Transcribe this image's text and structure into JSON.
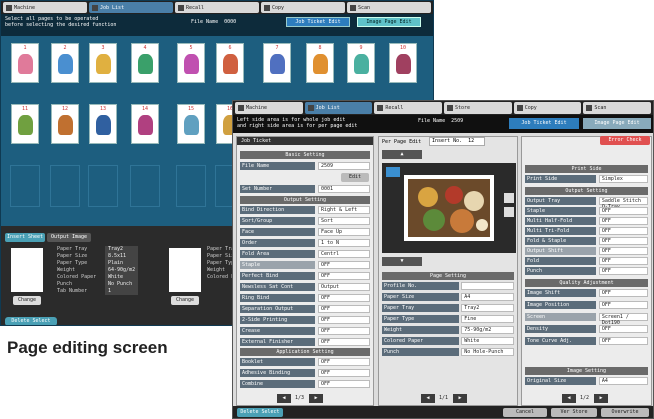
{
  "back_screen": {
    "tabs": [
      "Machine",
      "Job List",
      "Recall",
      "Copy",
      "Scan"
    ],
    "info_line1": "Select all pages to be operated",
    "info_line2": "before selecting the desired function",
    "file_name_label": "File Name",
    "file_name_value": "0000",
    "job_ticket_edit": "Job Ticket Edit",
    "image_page_edit": "Image Page Edit",
    "page_numbers": [
      "1",
      "2",
      "3",
      "4",
      "5",
      "6",
      "7",
      "8",
      "9",
      "10",
      "11",
      "12",
      "13",
      "14",
      "15",
      "16"
    ],
    "bottom_tabs": [
      "Insert Sheet",
      "Output Image"
    ],
    "sheet_labels": [
      "Paper Tray",
      "Paper Size",
      "Paper Type",
      "Weight",
      "Colored Paper",
      "Punch",
      "Tab Number"
    ],
    "sheet_values": [
      "Tray2",
      "8.5x11",
      "Plain",
      "64-90g/m2",
      "White",
      "No Punch",
      "1"
    ],
    "change_label": "Change",
    "delete_select": "Delete Select",
    "colors": {
      "accent": "#1d5e7f",
      "highlight": "#5fc2c9"
    }
  },
  "front_screen": {
    "tabs": [
      "Machine",
      "Job List",
      "Recall",
      "Store",
      "Copy",
      "Scan"
    ],
    "info_line1": "Left side area is for whole job edit",
    "info_line2": "and right side area is for per page edit",
    "file_name_label": "File Name",
    "file_name_value": "2509",
    "job_ticket_edit": "Job Ticket Edit",
    "image_page_edit": "Image Page Edit",
    "left_title": "Job Ticket",
    "basic_setting_header": "Basic Setting",
    "file_name_row": {
      "label": "File Name",
      "value": "2509"
    },
    "edit_btn": "Edit",
    "set_number_row": {
      "label": "Set Number",
      "value": "0001"
    },
    "output_setting_header": "Output Setting",
    "output_rows": [
      {
        "label": "Bind Direction",
        "value": "Right & Left"
      },
      {
        "label": "Sort/Group",
        "value": "Sort"
      },
      {
        "label": "Face",
        "value": "Face Up"
      },
      {
        "label": "Order",
        "value": "1 to N"
      },
      {
        "label": "Fold Area",
        "value": "Centrl"
      },
      {
        "label": "Staple",
        "value": "OFF"
      },
      {
        "label": "Perfect Bind",
        "value": "OFF"
      },
      {
        "label": "Newsless Sat Cont",
        "value": "Output"
      },
      {
        "label": "Ring Bind",
        "value": "OFF"
      },
      {
        "label": "Separation Output",
        "value": "OFF"
      },
      {
        "label": "2-Side Printing",
        "value": "OFF"
      },
      {
        "label": "Crease",
        "value": "OFF"
      },
      {
        "label": "External Finisher",
        "value": "OFF"
      }
    ],
    "application_header": "Application Setting",
    "application_rows": [
      {
        "label": "Booklet",
        "value": "OFF"
      },
      {
        "label": "Adhesive Binding",
        "value": "OFF"
      },
      {
        "label": "Combine",
        "value": "OFF"
      }
    ],
    "page_counter_left": "1/3",
    "per_page_edit": "Per Page Edit",
    "insert_no_label": "Insert No.",
    "insert_no_value": "12",
    "error_check": "Error Check",
    "page_setting_header": "Page Setting",
    "page_rows": [
      {
        "label": "Profile No.",
        "value": ""
      },
      {
        "label": "Paper Size",
        "value": "A4"
      },
      {
        "label": "Paper Tray",
        "value": "Tray2"
      },
      {
        "label": "Paper Type",
        "value": "Fine"
      },
      {
        "label": "Weight",
        "value": "75-90g/m2"
      },
      {
        "label": "Colored Paper",
        "value": "White"
      },
      {
        "label": "Punch",
        "value": "No Hole-Punch"
      }
    ],
    "page_counter_mid": "1/1",
    "print_side_header": "Print Side",
    "print_side_row": {
      "label": "Print Side",
      "value": "Simplex"
    },
    "output_setting_right_header": "Output Setting",
    "output_right_rows": [
      {
        "label": "Output Tray",
        "value": "Saddle Stitch O-Tray"
      },
      {
        "label": "Staple",
        "value": "OFF"
      },
      {
        "label": "Multi Half-Fold",
        "value": "OFF"
      },
      {
        "label": "Multi Tri-Fold",
        "value": "OFF"
      },
      {
        "label": "Fold & Staple",
        "value": "OFF"
      },
      {
        "label": "Output Shift",
        "value": "OFF"
      },
      {
        "label": "Fold",
        "value": "OFF"
      },
      {
        "label": "Punch",
        "value": "OFF"
      }
    ],
    "quality_header": "Quality Adjustment",
    "quality_rows": [
      {
        "label": "Image Shift",
        "value": "OFF"
      },
      {
        "label": "Image Position",
        "value": "OFF"
      },
      {
        "label": "Screen",
        "value": "Screen1 / Dot190"
      },
      {
        "label": "Density",
        "value": "OFF"
      },
      {
        "label": "Tone Curve Adj.",
        "value": "OFF"
      }
    ],
    "image_setting_header": "Image Setting",
    "original_size_row": {
      "label": "Original Size",
      "value": "A4"
    },
    "page_counter_right": "1/2",
    "bottom_buttons": [
      "Delete Select",
      "Cancel",
      "Ver Store",
      "Overwrite"
    ],
    "colors": {
      "selected_tab": "#4a7fa8",
      "job_ticket": "#2d7dbd"
    }
  },
  "caption": "Page editing screen"
}
